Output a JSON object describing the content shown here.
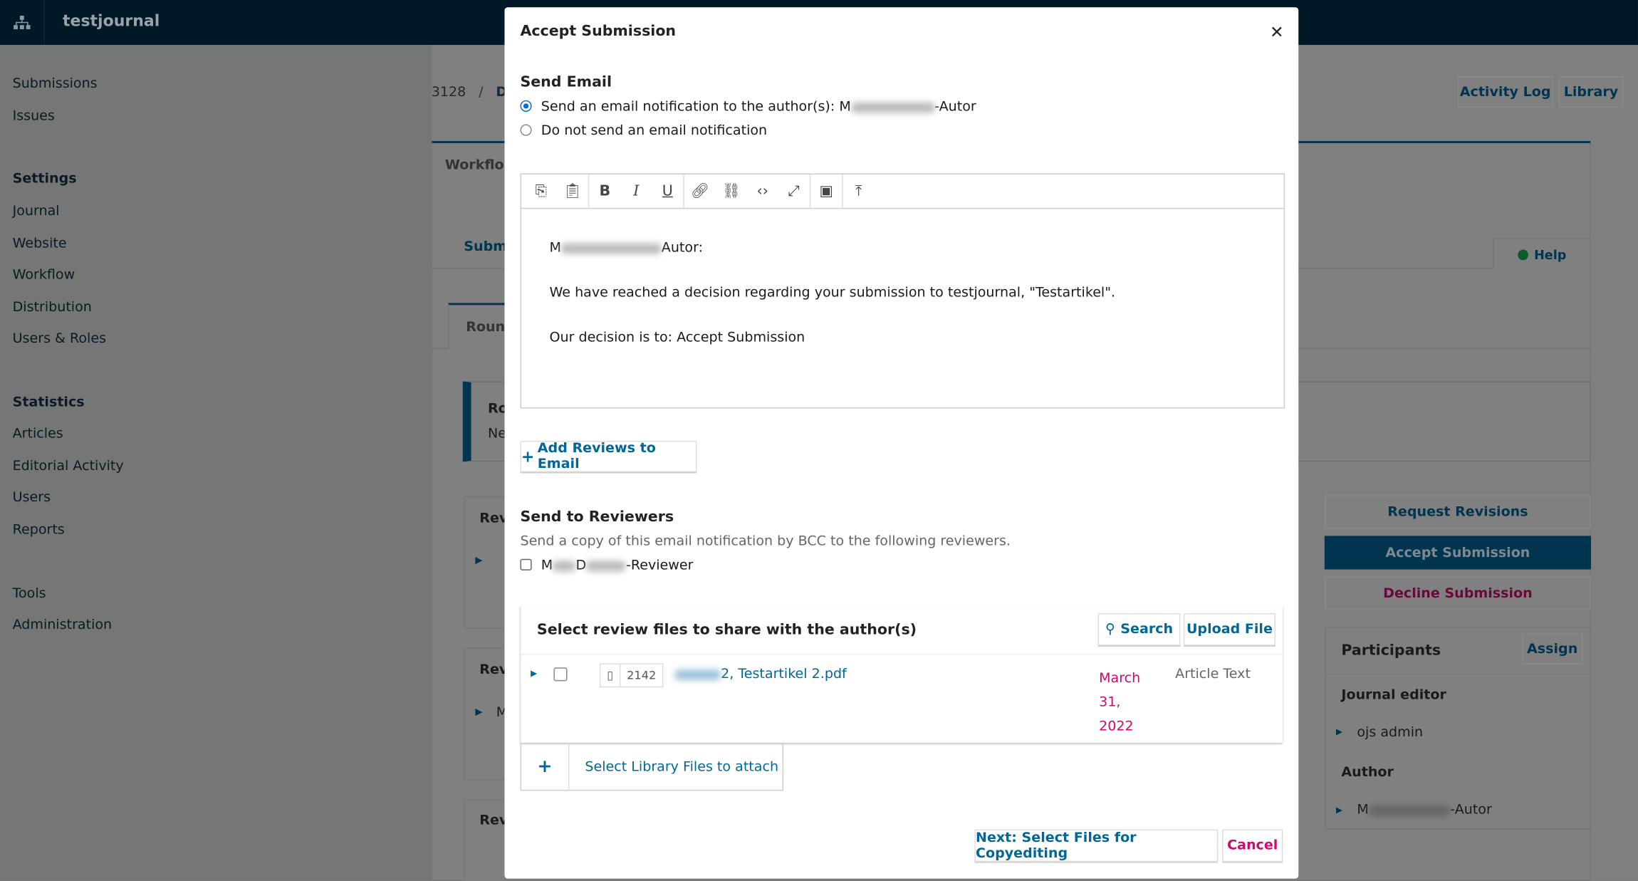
{
  "app": {
    "title": "testjournal",
    "logo_icon": "sitemap-icon"
  },
  "sidebar": {
    "items": [
      {
        "label": "Submissions",
        "heading": false
      },
      {
        "label": "Issues",
        "heading": false
      },
      {
        "label": "Settings",
        "heading": true
      },
      {
        "label": "Journal",
        "heading": false
      },
      {
        "label": "Website",
        "heading": false
      },
      {
        "label": "Workflow",
        "heading": false
      },
      {
        "label": "Distribution",
        "heading": false
      },
      {
        "label": "Users & Roles",
        "heading": false
      },
      {
        "label": "Statistics",
        "heading": true
      },
      {
        "label": "Articles",
        "heading": false
      },
      {
        "label": "Editorial Activity",
        "heading": false
      },
      {
        "label": "Users",
        "heading": false
      },
      {
        "label": "Reports",
        "heading": false
      },
      {
        "label": "Tools",
        "heading": false
      },
      {
        "label": "Administration",
        "heading": false
      }
    ]
  },
  "background": {
    "breadcrumb_id": "3128",
    "breadcrumb_sep": "/",
    "breadcrumb_title": "De",
    "tab_workflow": "Workflow",
    "tab_submission": "Subm",
    "tab_round": "Round",
    "round_title": "Ro",
    "round_text": "Ne",
    "rev_labels": [
      "Rev",
      "Rev",
      "Rev"
    ],
    "rev_row_m": "M",
    "activity_log": "Activity Log",
    "library": "Library",
    "help": "Help",
    "request_revisions": "Request Revisions",
    "accept_submission": "Accept Submission",
    "decline_submission": "Decline Submission",
    "participants": {
      "title": "Participants",
      "assign": "Assign",
      "groups": [
        {
          "role": "Journal editor",
          "name": "ojs admin",
          "name_suffix": ""
        },
        {
          "role": "Author",
          "name": "M",
          "name_suffix": "-Autor"
        }
      ]
    }
  },
  "modal": {
    "title": "Accept Submission",
    "close_icon": "close-icon",
    "send_email": {
      "heading": "Send Email",
      "options": [
        {
          "label": "Send an email notification to the author(s): M",
          "suffix": "-Autor",
          "selected": true
        },
        {
          "label": "Do not send an email notification",
          "selected": false
        }
      ]
    },
    "editor": {
      "toolbar": [
        "copy-icon",
        "paste-icon",
        "bold-icon",
        "italic-icon",
        "underline-icon",
        "link-icon",
        "unlink-icon",
        "code-icon",
        "fullscreen-icon",
        "image-icon",
        "upload-icon"
      ],
      "greeting_prefix": "M",
      "greeting_suffix": "Autor:",
      "paragraph1": "We have reached a decision regarding your submission to testjournal, \"Testartikel\".",
      "paragraph2": "Our decision is to: Accept Submission"
    },
    "add_reviews": "Add Reviews to Email",
    "reviewers": {
      "heading": "Send to Reviewers",
      "description": "Send a copy of this email notification by BCC to the following reviewers.",
      "items": [
        {
          "prefix": "M",
          "middle": "D",
          "suffix": "-Reviewer",
          "checked": false
        }
      ]
    },
    "files": {
      "heading": "Select review files to share with the author(s)",
      "search": "Search",
      "upload": "Upload File",
      "rows": [
        {
          "id": "2142",
          "name": "2, Testartikel 2.pdf",
          "date_lines": [
            "March",
            "31,",
            "2022"
          ],
          "type": "Article Text",
          "checked": false
        }
      ],
      "library": "Select Library Files to attach"
    },
    "next": "Next: Select Files for Copyediting",
    "cancel": "Cancel"
  },
  "colors": {
    "primary": "#006798",
    "danger": "#d00a6c",
    "radio": "#006cd9"
  }
}
